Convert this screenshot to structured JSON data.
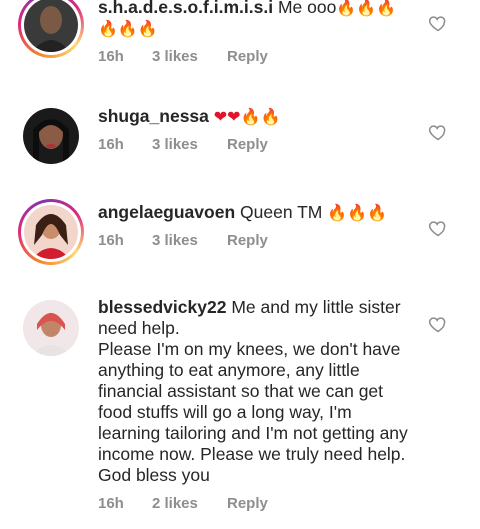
{
  "comments": [
    {
      "username": "s.h.a.d.e.s.o.f.i.m.i.s.i",
      "text": "Me ooo",
      "emojis": "🔥🔥🔥🔥🔥🔥",
      "time": "16h",
      "likes": "3 likes",
      "reply": "Reply"
    },
    {
      "username": "shuga_nessa",
      "text": "",
      "emojis": "❤❤🔥🔥",
      "time": "16h",
      "likes": "3 likes",
      "reply": "Reply"
    },
    {
      "username": "angelaeguavoen",
      "text": "Queen TM",
      "emojis": "🔥🔥🔥",
      "time": "16h",
      "likes": "3 likes",
      "reply": "Reply"
    },
    {
      "username": "blessedvicky22",
      "text": "Me and my little sister need help.\nPlease I'm on my knees, we don't have anything to eat anymore, any little financial assistant so that we can get food stuffs will go a long way, I'm learning tailoring and I'm not getting any income now. Please we truly need help. God bless you",
      "emojis": "",
      "time": "16h",
      "likes": "2 likes",
      "reply": "Reply"
    }
  ],
  "icons": {
    "like": "heart-outline-icon"
  },
  "colors": {
    "text": "#262626",
    "meta": "#8e8e8e",
    "fire": "#f57c00",
    "heart": "#e0142b"
  }
}
